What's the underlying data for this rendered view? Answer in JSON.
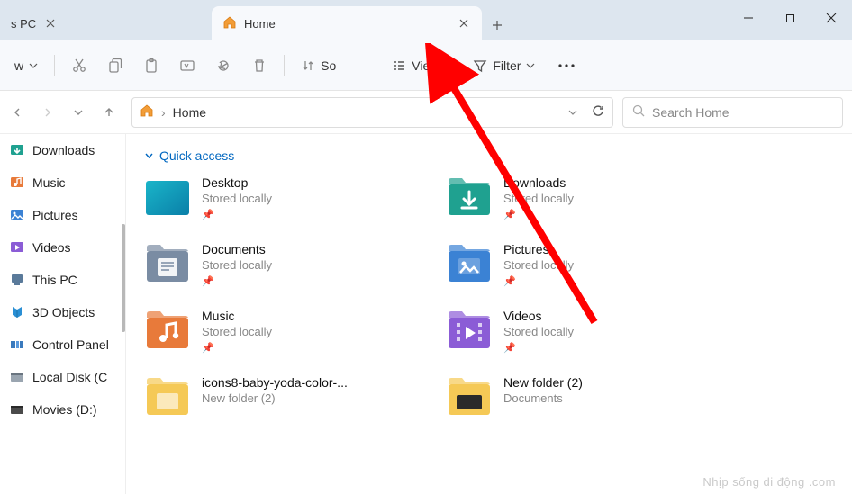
{
  "tabs": {
    "inactive_title": "s PC",
    "active_title": "Home"
  },
  "toolbar": {
    "new": "w",
    "sort": "So",
    "view": "View",
    "filter": "Filter"
  },
  "addressbar": {
    "location": "Home",
    "sep": "›"
  },
  "search": {
    "placeholder": "Search Home"
  },
  "sidebar": {
    "items": [
      "Downloads",
      "Music",
      "Pictures",
      "Videos",
      "This PC",
      "3D Objects",
      "Control Panel",
      "Local Disk (C",
      "Movies (D:)"
    ]
  },
  "group": {
    "name": "Quick access"
  },
  "items": [
    {
      "name": "Desktop",
      "sub": "Stored locally",
      "pin": true,
      "icon": "desktop"
    },
    {
      "name": "Downloads",
      "sub": "Stored locally",
      "pin": true,
      "icon": "downloads"
    },
    {
      "name": "Documents",
      "sub": "Stored locally",
      "pin": true,
      "icon": "documents"
    },
    {
      "name": "Pictures",
      "sub": "Stored locally",
      "pin": true,
      "icon": "pictures"
    },
    {
      "name": "Music",
      "sub": "Stored locally",
      "pin": true,
      "icon": "music"
    },
    {
      "name": "Videos",
      "sub": "Stored locally",
      "pin": true,
      "icon": "videos"
    },
    {
      "name": "icons8-baby-yoda-color-...",
      "sub": "New folder (2)",
      "pin": false,
      "icon": "folder"
    },
    {
      "name": "New folder (2)",
      "sub": "Documents",
      "pin": false,
      "icon": "folder-dark"
    }
  ],
  "watermark": "Nhịp sống di động .com"
}
